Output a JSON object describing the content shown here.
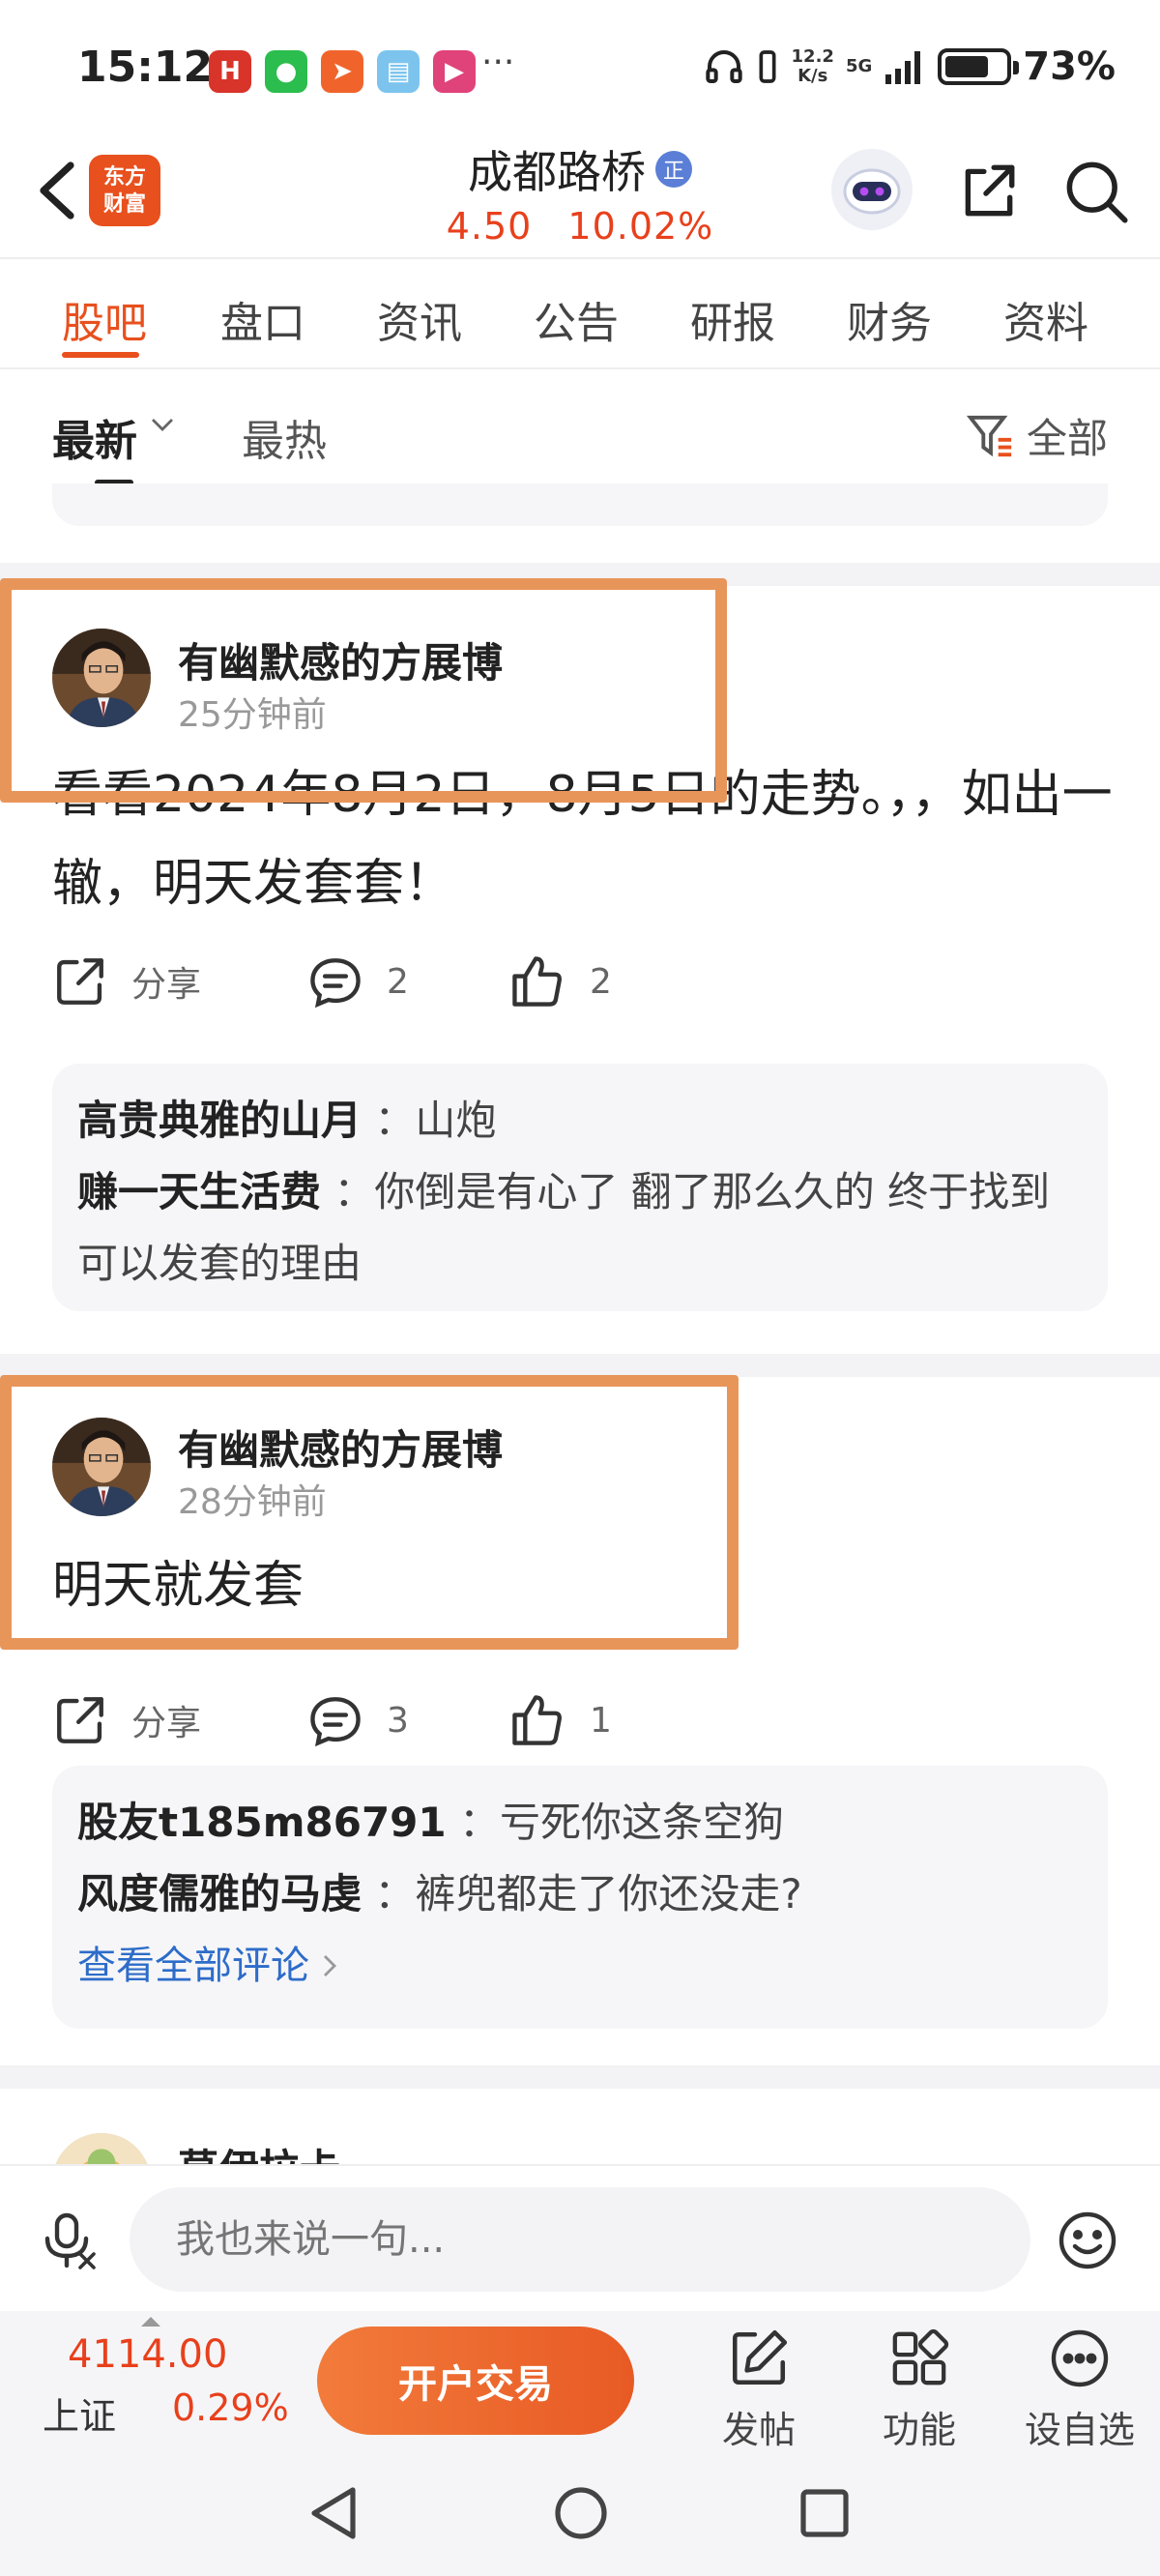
{
  "status": {
    "time": "15:12",
    "more_indicator": "···",
    "net_speed_value": "12.2",
    "net_speed_unit": "K/s",
    "network": "5G",
    "battery_pct": "73%",
    "battery_level": 0.73
  },
  "header": {
    "logo_line1": "东方",
    "logo_line2": "财富",
    "stock_name": "成都路桥",
    "stock_badge": "正",
    "price": "4.50",
    "change_pct": "10.02%",
    "accent_color": "#e8501e",
    "up_color": "#e8401c"
  },
  "tabs": [
    {
      "label": "股吧"
    },
    {
      "label": "盘口"
    },
    {
      "label": "资讯"
    },
    {
      "label": "公告"
    },
    {
      "label": "研报"
    },
    {
      "label": "财务"
    },
    {
      "label": "资料"
    }
  ],
  "sort": {
    "latest": "最新",
    "hot": "最热",
    "filter": "全部"
  },
  "posts": [
    {
      "author": "有幽默感的方展博",
      "time": "25分钟前",
      "body": "看看2024年8月2日，8月5日的走势。，，如出一辙，明天发套套！",
      "share_label": "分享",
      "comment_count": "2",
      "like_count": "2",
      "comments": [
        {
          "user": "高贵典雅的山月",
          "text": "：山炮"
        },
        {
          "user": "赚一天生活费",
          "text": "：你倒是有心了  翻了那么久的 终于找到可以发套的理由"
        }
      ]
    },
    {
      "author": "有幽默感的方展博",
      "time": "28分钟前",
      "body": "明天就发套",
      "share_label": "分享",
      "comment_count": "3",
      "like_count": "1",
      "comments": [
        {
          "user": "股友t185m86791",
          "text": "：亏死你这条空狗"
        },
        {
          "user": "风度儒雅的马虔",
          "text": "：裤兜都走了你还没走?"
        }
      ],
      "view_all": "查看全部评论"
    }
  ],
  "next_post_author": "莫伊拉卡",
  "input": {
    "placeholder": "我也来说一句..."
  },
  "bottom": {
    "index_value": "4114.00",
    "index_name": "上证",
    "index_change": "0.29%",
    "trade_label": "开户交易",
    "post_label": "发帖",
    "function_label": "功能",
    "watchlist_label": "设自选"
  },
  "highlight_color": "#e8955a"
}
